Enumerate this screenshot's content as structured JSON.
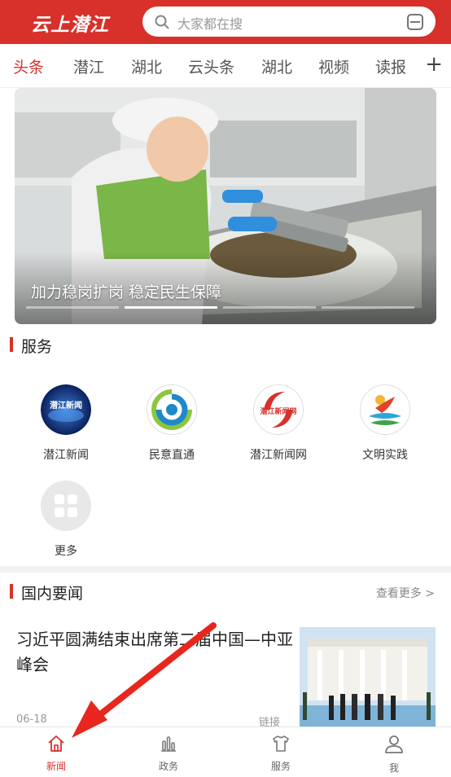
{
  "header": {
    "logo": "云上潜江",
    "search_placeholder": "大家都在搜"
  },
  "tabs": [
    "头条",
    "潜江",
    "湖北",
    "云头条",
    "湖北",
    "视频",
    "读报"
  ],
  "tabs_plus": "+",
  "banner": {
    "caption": "加力稳岗扩岗 稳定民生保障",
    "slide_count": 4,
    "active_slide": 2
  },
  "services": {
    "title": "服务",
    "items": [
      {
        "label": "潜江新闻",
        "icon": "qianjiang-news-logo"
      },
      {
        "label": "民意直通",
        "icon": "public-opinion-logo"
      },
      {
        "label": "潜江新闻网",
        "icon": "qianjiang-news-web-logo"
      },
      {
        "label": "文明实践",
        "icon": "civilization-practice-logo"
      },
      {
        "label": "更多",
        "icon": "grid-icon"
      }
    ],
    "logo_text_1": "潜江新闻",
    "logo_text_3": "潜江新闻网"
  },
  "news": {
    "title": "国内要闻",
    "more": "查看更多 >",
    "item": {
      "title": "习近平圆满结束出席第二届中国—中亚峰会",
      "date": "06-18",
      "tag": "链接"
    }
  },
  "bottom_nav": [
    {
      "label": "新闻",
      "icon": "home-icon",
      "active": true
    },
    {
      "label": "政务",
      "icon": "bar-chart-icon",
      "active": false
    },
    {
      "label": "服务",
      "icon": "shirt-icon",
      "active": false
    },
    {
      "label": "我",
      "icon": "user-icon",
      "active": false
    }
  ],
  "colors": {
    "brand": "#d8302a"
  }
}
